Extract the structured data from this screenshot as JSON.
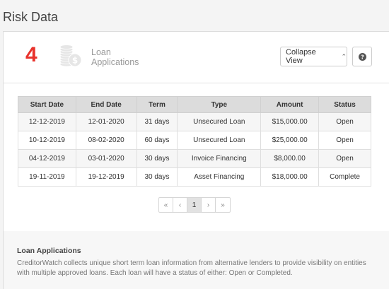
{
  "page": {
    "title": "Risk Data"
  },
  "summary": {
    "count": "4",
    "label": "Loan Applications",
    "collapse_label": "Collapse View",
    "icon": "coins-icon",
    "count_color": "#e8322c"
  },
  "table": {
    "headers": [
      "Start Date",
      "End Date",
      "Term",
      "Type",
      "Amount",
      "Status"
    ],
    "rows": [
      [
        "12-12-2019",
        "12-01-2020",
        "31 days",
        "Unsecured Loan",
        "$15,000.00",
        "Open"
      ],
      [
        "10-12-2019",
        "08-02-2020",
        "60 days",
        "Unsecured Loan",
        "$25,000.00",
        "Open"
      ],
      [
        "04-12-2019",
        "03-01-2020",
        "30 days",
        "Invoice Financing",
        "$8,000.00",
        "Open"
      ],
      [
        "19-11-2019",
        "19-12-2019",
        "30 days",
        "Asset Financing",
        "$18,000.00",
        "Complete"
      ]
    ]
  },
  "pagination": {
    "first": "«",
    "prev": "‹",
    "current": "1",
    "next": "›",
    "last": "»"
  },
  "info": {
    "title": "Loan Applications",
    "text": "CreditorWatch collects unique short term loan information from alternative lenders to provide visibility on entities with multiple approved loans. Each loan will have a status of either: Open or Completed."
  }
}
